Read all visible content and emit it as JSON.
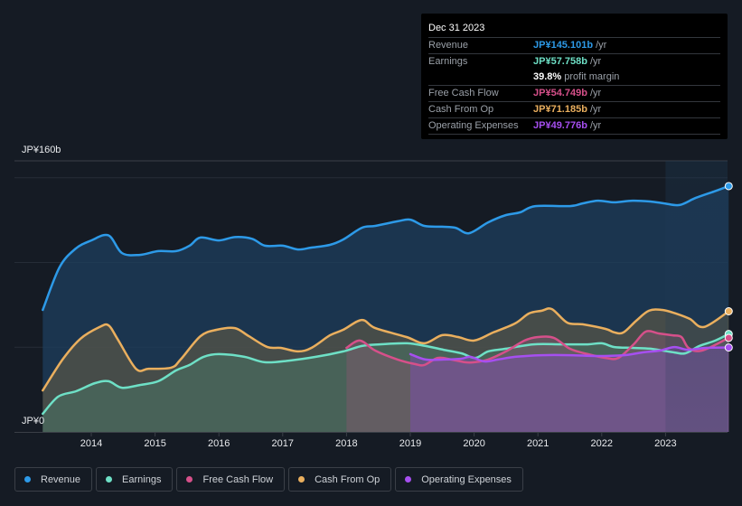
{
  "tooltip": {
    "date": "Dec 31 2023",
    "rows": [
      {
        "label": "Revenue",
        "value": "JP¥145.101b",
        "unit": " /yr",
        "color": "#2d9ae8"
      },
      {
        "label": "Earnings",
        "value": "JP¥57.758b",
        "unit": " /yr",
        "color": "#6ee0c6"
      },
      {
        "label": "",
        "value": "39.8%",
        "unit": " profit margin",
        "color": "#ffffff"
      },
      {
        "label": "Free Cash Flow",
        "value": "JP¥54.749b",
        "unit": " /yr",
        "color": "#d6508a"
      },
      {
        "label": "Cash From Op",
        "value": "JP¥71.185b",
        "unit": " /yr",
        "color": "#eaaf5e"
      },
      {
        "label": "Operating Expenses",
        "value": "JP¥49.776b",
        "unit": " /yr",
        "color": "#a64ff0"
      }
    ]
  },
  "legend": [
    {
      "label": "Revenue",
      "color": "#2d9ae8"
    },
    {
      "label": "Earnings",
      "color": "#6ee0c6"
    },
    {
      "label": "Free Cash Flow",
      "color": "#d6508a"
    },
    {
      "label": "Cash From Op",
      "color": "#eaaf5e"
    },
    {
      "label": "Operating Expenses",
      "color": "#a64ff0"
    }
  ],
  "chart_data": {
    "type": "area",
    "title": "",
    "xlabel": "",
    "ylabel": "",
    "unit": "JP¥ billions",
    "y_tick_labels": [
      "JP¥160b",
      "JP¥0"
    ],
    "ylim": [
      0,
      160
    ],
    "xlim": [
      2013.25,
      2024.0
    ],
    "x_tick_labels": [
      "2014",
      "2015",
      "2016",
      "2017",
      "2018",
      "2019",
      "2020",
      "2021",
      "2022",
      "2023"
    ],
    "x_ticks": [
      2014,
      2015,
      2016,
      2017,
      2018,
      2019,
      2020,
      2021,
      2022,
      2023
    ],
    "highlight_from": 2023.0,
    "grid": true,
    "legend_position": "bottom",
    "series": [
      {
        "name": "Revenue",
        "color": "#2d9ae8",
        "x": [
          2013.24,
          2013.5,
          2013.75,
          2014.0,
          2014.27,
          2014.48,
          2014.76,
          2015.05,
          2015.33,
          2015.54,
          2015.71,
          2016.0,
          2016.25,
          2016.52,
          2016.72,
          2017.0,
          2017.24,
          2017.45,
          2017.74,
          2017.95,
          2018.24,
          2018.45,
          2018.8,
          2019.0,
          2019.22,
          2019.5,
          2019.71,
          2019.92,
          2020.22,
          2020.5,
          2020.72,
          2020.96,
          2021.5,
          2021.7,
          2021.94,
          2022.2,
          2022.48,
          2022.76,
          2022.98,
          2023.22,
          2023.47,
          2023.76,
          2023.99
        ],
        "values": [
          72,
          97,
          108,
          113,
          116,
          105.6,
          104.5,
          106.7,
          106.7,
          109.9,
          114.7,
          113,
          115,
          114,
          109.9,
          109.9,
          107.7,
          108.8,
          110.4,
          113.6,
          120.5,
          121.6,
          124.3,
          125.3,
          121.6,
          121.1,
          120.5,
          117.3,
          123.7,
          128,
          129.6,
          133.3,
          133.3,
          134.9,
          136.5,
          135.5,
          136.5,
          136,
          134.9,
          133.9,
          138.1,
          141.9,
          145.1
        ]
      },
      {
        "name": "Earnings",
        "color": "#6ee0c6",
        "x": [
          2013.24,
          2013.48,
          2013.76,
          2014.06,
          2014.27,
          2014.48,
          2014.76,
          2015.05,
          2015.33,
          2015.54,
          2015.76,
          2016.0,
          2016.4,
          2016.72,
          2017.1,
          2017.52,
          2017.95,
          2018.24,
          2018.52,
          2018.95,
          2019.24,
          2019.52,
          2019.8,
          2020.02,
          2020.22,
          2020.5,
          2020.93,
          2021.36,
          2021.78,
          2022.0,
          2022.2,
          2022.48,
          2022.76,
          2023.14,
          2023.31,
          2023.53,
          2023.78,
          2023.99
        ],
        "values": [
          10.7,
          20.8,
          24,
          28.8,
          29.9,
          26.1,
          27.7,
          29.9,
          36.3,
          39.5,
          44.3,
          45.9,
          44.3,
          41.1,
          42.1,
          44.3,
          47.5,
          50.7,
          51.7,
          52.3,
          50.7,
          48.5,
          46.4,
          43.7,
          47.5,
          49.1,
          51.7,
          51.7,
          51.7,
          52.3,
          50.1,
          49.6,
          49.1,
          46.9,
          46.4,
          50.7,
          53.9,
          57.8
        ]
      },
      {
        "name": "Free Cash Flow",
        "color": "#d6508a",
        "x": [
          2018.0,
          2018.21,
          2018.45,
          2018.8,
          2019.08,
          2019.22,
          2019.43,
          2019.64,
          2019.86,
          2020.0,
          2020.22,
          2020.5,
          2020.79,
          2021.0,
          2021.25,
          2021.5,
          2021.78,
          2022.06,
          2022.26,
          2022.5,
          2022.69,
          2022.9,
          2023.11,
          2023.25,
          2023.36,
          2023.57,
          2023.99
        ],
        "values": [
          49.6,
          53.9,
          48,
          42.7,
          40,
          39.5,
          43.7,
          42.7,
          41.1,
          41.1,
          42.7,
          47.5,
          53.9,
          56,
          55.5,
          49.1,
          45.9,
          43.7,
          43.7,
          51.7,
          59.2,
          58.1,
          57,
          56,
          49.6,
          48,
          55.5
        ]
      },
      {
        "name": "Cash From Op",
        "color": "#eaaf5e",
        "x": [
          2013.24,
          2013.55,
          2013.83,
          2014.13,
          2014.27,
          2014.41,
          2014.7,
          2014.9,
          2015.25,
          2015.4,
          2015.71,
          2015.97,
          2016.25,
          2016.47,
          2016.76,
          2016.97,
          2017.24,
          2017.45,
          2017.74,
          2017.95,
          2018.24,
          2018.45,
          2018.94,
          2019.22,
          2019.5,
          2019.75,
          2020.0,
          2020.3,
          2020.64,
          2020.86,
          2021.06,
          2021.22,
          2021.46,
          2021.7,
          2022.06,
          2022.2,
          2022.34,
          2022.54,
          2022.74,
          2022.95,
          2023.16,
          2023.38,
          2023.6,
          2023.99
        ],
        "values": [
          24.5,
          42.7,
          55,
          61.9,
          62.9,
          55,
          37.3,
          37.3,
          37.9,
          42.7,
          56.5,
          60.3,
          61.3,
          56.5,
          50.1,
          49.6,
          47.5,
          49.6,
          57,
          60.3,
          66.1,
          61.3,
          56,
          52.3,
          57.1,
          56,
          53.9,
          58.7,
          64,
          69.9,
          71.5,
          72.5,
          64.5,
          63.5,
          60.8,
          58.7,
          58.7,
          65.6,
          71.5,
          72,
          69.9,
          66.7,
          61.9,
          71.2
        ]
      },
      {
        "name": "Operating Expenses",
        "color": "#a64ff0",
        "x": [
          2019.0,
          2019.24,
          2019.52,
          2019.8,
          2019.94,
          2020.16,
          2020.37,
          2020.64,
          2021.06,
          2021.5,
          2021.92,
          2022.35,
          2022.63,
          2022.91,
          2023.14,
          2023.35,
          2023.63,
          2023.99
        ],
        "values": [
          45.9,
          42.7,
          42.7,
          43.2,
          44.3,
          41.6,
          42.7,
          44.3,
          45.3,
          45.3,
          44.8,
          45.3,
          46.9,
          48,
          50.1,
          48.5,
          49.6,
          49.8
        ]
      }
    ]
  }
}
